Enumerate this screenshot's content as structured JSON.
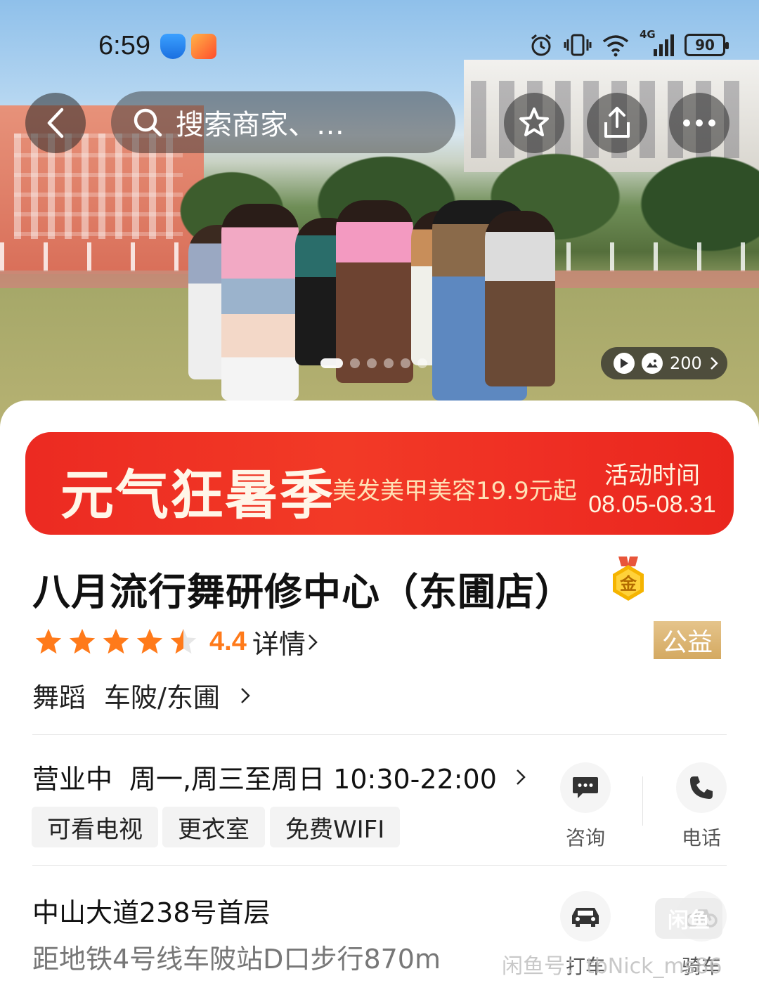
{
  "status_bar": {
    "time": "6:59",
    "battery": "90",
    "network": "4G",
    "icons": [
      "shield-app-icon",
      "taobao-app-icon",
      "alarm-icon",
      "vibrate-icon",
      "wifi-icon",
      "signal-icon",
      "battery-icon"
    ]
  },
  "nav": {
    "search_placeholder": "搜索商家、…",
    "icons": [
      "back-icon",
      "search-icon",
      "star-icon",
      "share-icon",
      "more-icon"
    ]
  },
  "gallery": {
    "media_count": "200",
    "page_count": 6,
    "active_page": 1
  },
  "promo_banner": {
    "title": "元气狂暑季",
    "subtitle": "美发美甲美容19.9元起",
    "time_label": "活动时间",
    "time_value": "08.05-08.31",
    "color": "#ef2f24"
  },
  "shop": {
    "name": "八月流行舞研修中心（东圃店）",
    "gold_badge": "金",
    "rating": 4.4,
    "rating_text": "4.4",
    "detail_label": "详情",
    "public_badge": "公益",
    "category": "舞蹈",
    "area": "车陂/东圃",
    "accent_color": "#ff7a1a"
  },
  "hours": {
    "status": "营业中",
    "schedule": "周一,周三至周日 10:30-22:00"
  },
  "facilities": [
    "可看电视",
    "更衣室",
    "免费WIFI"
  ],
  "actions": {
    "consult": "咨询",
    "phone": "电话",
    "taxi": "打车",
    "bike": "骑车"
  },
  "address": {
    "line": "中山大道238号首层",
    "distance": "距地铁4号线车陂站D口步行870m"
  },
  "watermark": {
    "text": "闲鱼号：tbNick_ms86",
    "logo": "闲鱼"
  }
}
